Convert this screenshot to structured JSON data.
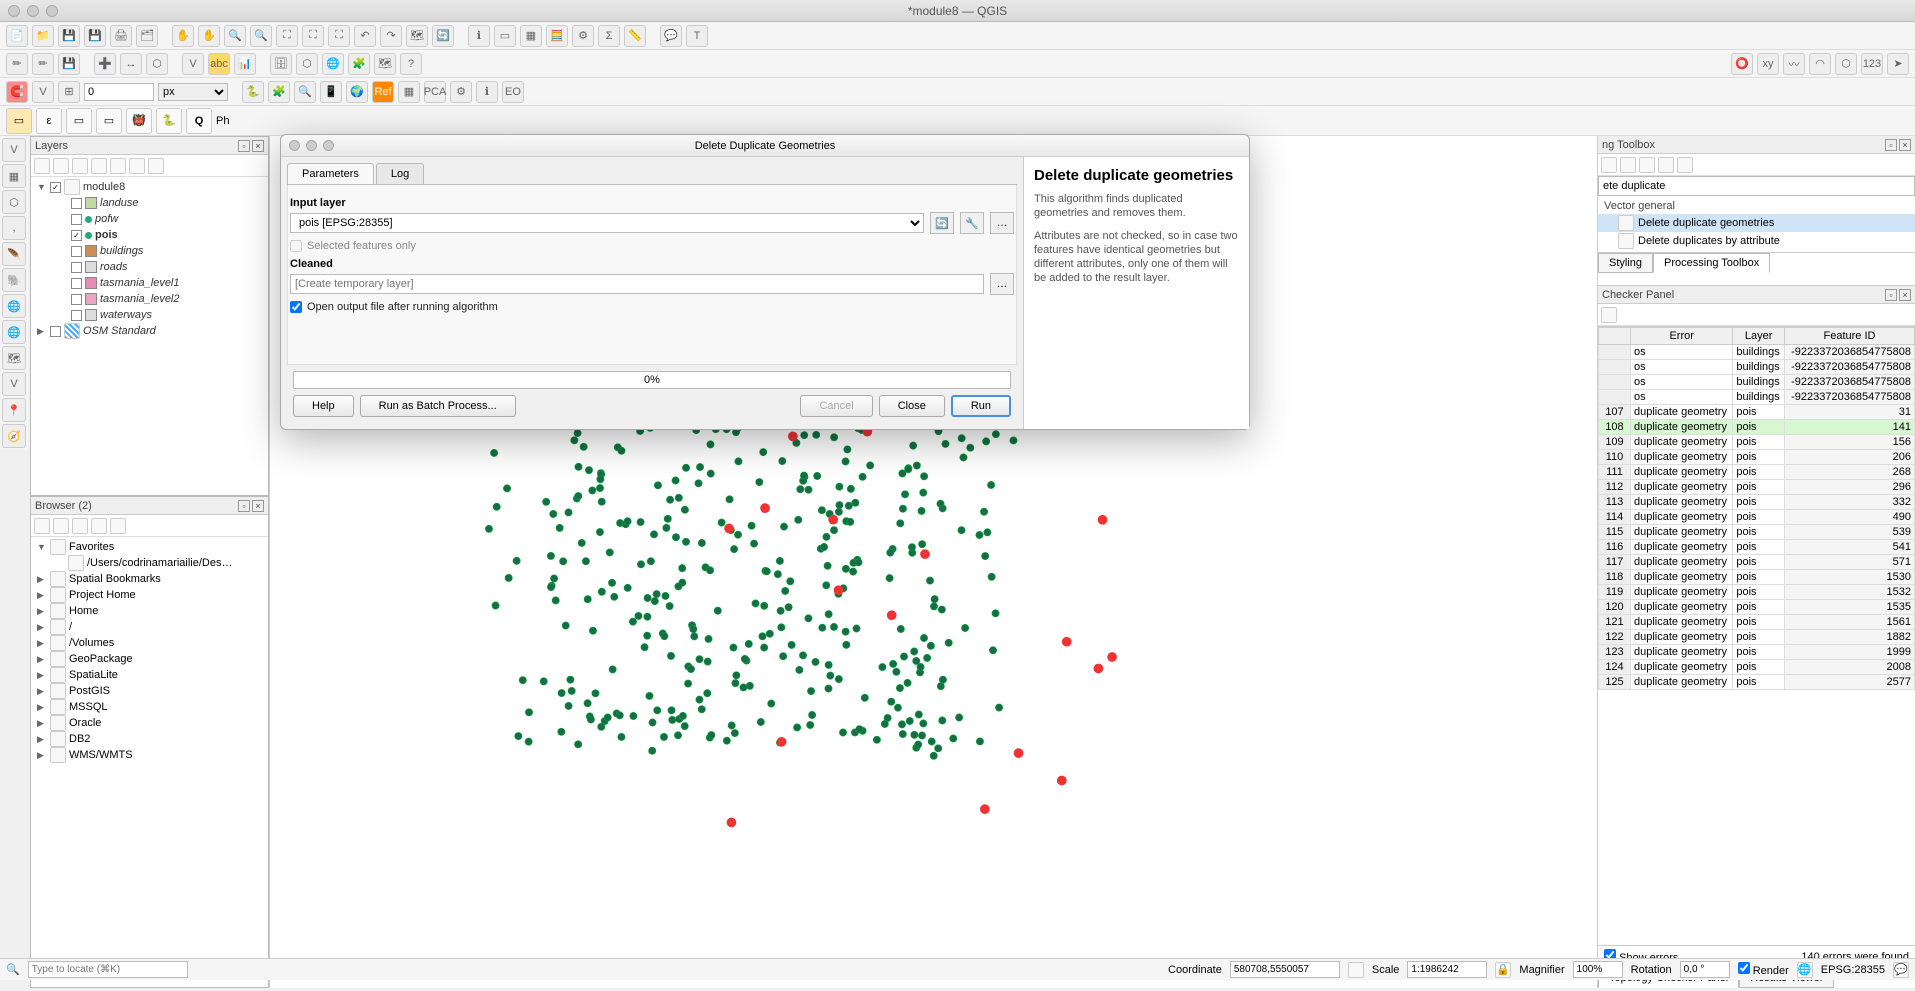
{
  "window": {
    "title": "*module8 — QGIS"
  },
  "statusbar": {
    "locator_placeholder": "Type to locate (⌘K)",
    "coord_label": "Coordinate",
    "coord_value": "580708,5550057",
    "scale_label": "Scale",
    "scale_value": "1:1986242",
    "mag_label": "Magnifier",
    "mag_value": "100%",
    "rot_label": "Rotation",
    "rot_value": "0,0 °",
    "render_label": "Render",
    "crs": "EPSG:28355"
  },
  "layers_panel": {
    "title": "Layers",
    "root": "module8",
    "items": [
      {
        "name": "landuse",
        "checked": false,
        "swatch": "#c5d9a5",
        "italic": true
      },
      {
        "name": "pofw",
        "checked": false,
        "swatch": "#fff",
        "italic": true,
        "dot": true
      },
      {
        "name": "pois",
        "checked": true,
        "swatch": "#fff",
        "italic": false,
        "bold": true,
        "dot": true
      },
      {
        "name": "buildings",
        "checked": false,
        "swatch": "#c98f54",
        "italic": true
      },
      {
        "name": "roads",
        "checked": false,
        "swatch": "#ddd",
        "italic": true
      },
      {
        "name": "tasmania_level1",
        "checked": false,
        "swatch": "#e38fb5",
        "italic": true
      },
      {
        "name": "tasmania_level2",
        "checked": false,
        "swatch": "#e8a5c4",
        "italic": true
      },
      {
        "name": "waterways",
        "checked": false,
        "swatch": "#ddd",
        "italic": true
      }
    ],
    "osm": "OSM Standard"
  },
  "browser_panel": {
    "title": "Browser (2)",
    "items": [
      "Favorites",
      "/Users/codrinamariailie/Des…",
      "Spatial Bookmarks",
      "Project Home",
      "Home",
      "/",
      "/Volumes",
      "GeoPackage",
      "SpatiaLite",
      "PostGIS",
      "MSSQL",
      "Oracle",
      "DB2",
      "WMS/WMTS"
    ]
  },
  "toolbox": {
    "title": "ng Toolbox",
    "search": "ete duplicate",
    "group": "Vector general",
    "items": [
      "Delete duplicate geometries",
      "Delete duplicates by attribute"
    ],
    "tab_styling": "Styling",
    "tab_processing": "Processing Toolbox"
  },
  "checker": {
    "title": "Checker Panel",
    "cols": {
      "error": "Error",
      "layer": "Layer",
      "fid": "Feature ID"
    },
    "rows_top": [
      {
        "err": "os",
        "layer": "buildings",
        "fid": "-9223372036854775808"
      },
      {
        "err": "os",
        "layer": "buildings",
        "fid": "-9223372036854775808"
      },
      {
        "err": "os",
        "layer": "buildings",
        "fid": "-9223372036854775808"
      },
      {
        "err": "os",
        "layer": "buildings",
        "fid": "-9223372036854775808"
      }
    ],
    "rows_num": [
      {
        "n": 107,
        "err": "duplicate geometry",
        "layer": "pois",
        "fid": 31,
        "hl": false
      },
      {
        "n": 108,
        "err": "duplicate geometry",
        "layer": "pois",
        "fid": 141,
        "hl": true
      },
      {
        "n": 109,
        "err": "duplicate geometry",
        "layer": "pois",
        "fid": 156,
        "hl": false
      },
      {
        "n": 110,
        "err": "duplicate geometry",
        "layer": "pois",
        "fid": 206,
        "hl": false
      },
      {
        "n": 111,
        "err": "duplicate geometry",
        "layer": "pois",
        "fid": 268,
        "hl": false
      },
      {
        "n": 112,
        "err": "duplicate geometry",
        "layer": "pois",
        "fid": 296,
        "hl": false
      },
      {
        "n": 113,
        "err": "duplicate geometry",
        "layer": "pois",
        "fid": 332,
        "hl": false
      },
      {
        "n": 114,
        "err": "duplicate geometry",
        "layer": "pois",
        "fid": 490,
        "hl": false
      },
      {
        "n": 115,
        "err": "duplicate geometry",
        "layer": "pois",
        "fid": 539,
        "hl": false
      },
      {
        "n": 116,
        "err": "duplicate geometry",
        "layer": "pois",
        "fid": 541,
        "hl": false
      },
      {
        "n": 117,
        "err": "duplicate geometry",
        "layer": "pois",
        "fid": 571,
        "hl": false
      },
      {
        "n": 118,
        "err": "duplicate geometry",
        "layer": "pois",
        "fid": 1530,
        "hl": false
      },
      {
        "n": 119,
        "err": "duplicate geometry",
        "layer": "pois",
        "fid": 1532,
        "hl": false
      },
      {
        "n": 120,
        "err": "duplicate geometry",
        "layer": "pois",
        "fid": 1535,
        "hl": false
      },
      {
        "n": 121,
        "err": "duplicate geometry",
        "layer": "pois",
        "fid": 1561,
        "hl": false
      },
      {
        "n": 122,
        "err": "duplicate geometry",
        "layer": "pois",
        "fid": 1882,
        "hl": false
      },
      {
        "n": 123,
        "err": "duplicate geometry",
        "layer": "pois",
        "fid": 1999,
        "hl": false
      },
      {
        "n": 124,
        "err": "duplicate geometry",
        "layer": "pois",
        "fid": 2008,
        "hl": false
      },
      {
        "n": 125,
        "err": "duplicate geometry",
        "layer": "pois",
        "fid": 2577,
        "hl": false
      }
    ],
    "show_errors": "Show errors",
    "found": "140 errors were found",
    "tab_topology": "Topology Checker Panel",
    "tab_results": "Results Viewer"
  },
  "dialog": {
    "title": "Delete Duplicate Geometries",
    "tab_parameters": "Parameters",
    "tab_log": "Log",
    "input_label": "Input layer",
    "input_value": "pois [EPSG:28355]",
    "selected_only": "Selected features only",
    "cleaned_label": "Cleaned",
    "cleaned_placeholder": "[Create temporary layer]",
    "open_output": "Open output file after running algorithm",
    "help_title": "Delete duplicate geometries",
    "help_p1": "This algorithm finds duplicated geometries and removes them.",
    "help_p2": "Attributes are not checked, so in case two features have identical geometries but different attributes, only one of them will be added to the result layer.",
    "progress": "0%",
    "btn_help": "Help",
    "btn_batch": "Run as Batch Process...",
    "btn_cancel": "Cancel",
    "btn_close": "Close",
    "btn_run": "Run"
  },
  "spin": {
    "value": "0",
    "unit": "px"
  },
  "locator": {
    "label": "Q",
    "text": "Ph"
  }
}
